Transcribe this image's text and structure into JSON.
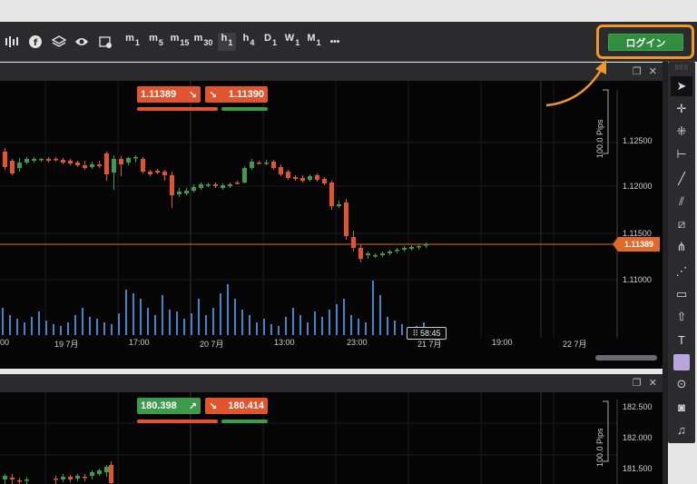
{
  "toolbar": {
    "timeframes": [
      {
        "key": "m",
        "sub": "1"
      },
      {
        "key": "m",
        "sub": "5"
      },
      {
        "key": "m",
        "sub": "15"
      },
      {
        "key": "m",
        "sub": "30"
      },
      {
        "key": "h",
        "sub": "1"
      },
      {
        "key": "h",
        "sub": "4"
      },
      {
        "key": "D",
        "sub": "1"
      },
      {
        "key": "W",
        "sub": "1"
      },
      {
        "key": "M",
        "sub": "1"
      }
    ],
    "more_label": "•••",
    "login_label": "ログイン"
  },
  "chart1": {
    "bid_value": "1.11389",
    "ask_value": "1.11390",
    "pips_label": "100.0 Pips",
    "price_ticks": [
      "1.12500",
      "1.12000",
      "1.11500",
      "1.11000"
    ],
    "current_price": "1.11389",
    "time_ticks": [
      "00",
      "19 7月",
      "17:00",
      "20 7月",
      "13:00",
      "23:00",
      "21 7月",
      "19:00",
      "22 7月"
    ],
    "countdown": "58:45"
  },
  "chart2": {
    "bid_value": "180.398",
    "ask_value": "180.414",
    "pips_label": "100.0 Pips",
    "price_ticks": [
      "182.500",
      "182.000",
      "181.500"
    ]
  },
  "colors": {
    "bear": "#e0552e",
    "bull": "#3e9a4c",
    "accent": "#f0962a",
    "login_green": "#2f8f3f",
    "volume": "#3f86c8"
  }
}
